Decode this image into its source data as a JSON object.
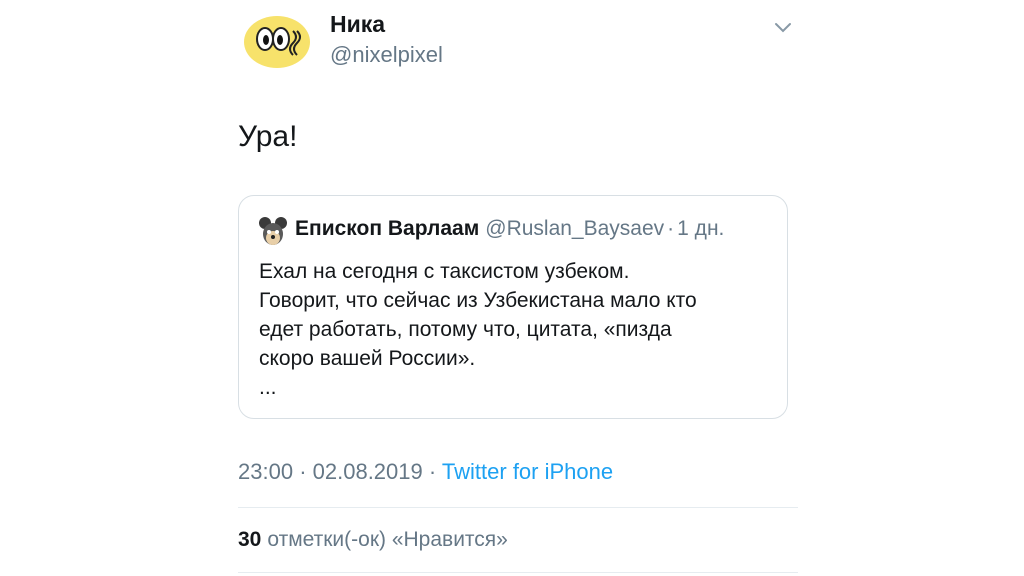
{
  "tweet": {
    "author_name": "Ника",
    "author_handle": "@nixelpixel",
    "text": "Ура!",
    "time": "23:00",
    "date": "02.08.2019",
    "separator": "·",
    "source": "Twitter for iPhone",
    "likes_count": "30",
    "likes_label": "отметки(-ок) «Нравится»"
  },
  "quote": {
    "author_name": "Епископ Варлаам",
    "author_handle": "@Ruslan_Baysaev",
    "separator": "·",
    "time_ago": "1 дн.",
    "lines": [
      "Ехал на сегодня с таксистом узбеком.",
      "Говорит, что сейчас из Узбекистана мало кто",
      "едет работать, потому что, цитата, «пизда",
      "скоро вашей России».",
      "..."
    ]
  },
  "colors": {
    "link": "#1da1f2",
    "secondary_text": "#657786",
    "primary_text": "#14171a",
    "avatar_yellow": "#f7e26b"
  },
  "icons": {
    "menu": "chevron-down-icon"
  }
}
